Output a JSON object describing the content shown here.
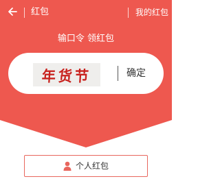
{
  "colors": {
    "brand_red": "#ee584f",
    "button_border": "#e8665d",
    "captcha_red": "#c8211d"
  },
  "header": {
    "back_icon": "arrow-left-icon",
    "title": "红包",
    "my_redpacket_link": "我的红包"
  },
  "main": {
    "prompt": "输口令 领红包",
    "code_input": {
      "captcha_text": "年货节",
      "confirm_label": "确定"
    }
  },
  "footer": {
    "personal_button": {
      "icon": "person-icon",
      "label": "个人红包"
    }
  }
}
